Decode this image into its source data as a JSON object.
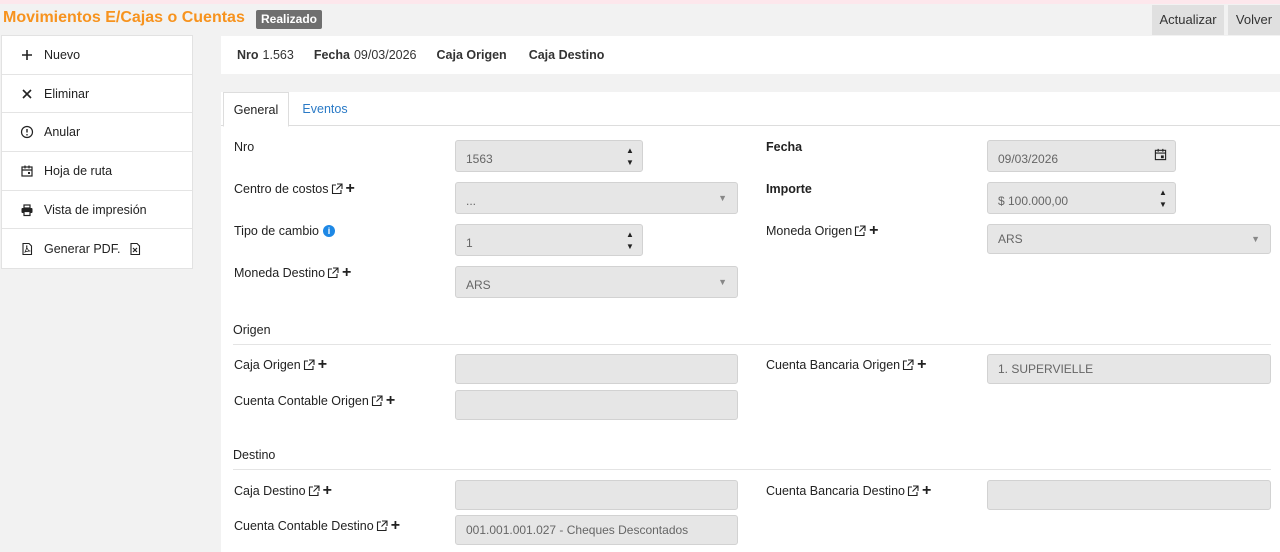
{
  "header": {
    "title": "Movimientos E/Cajas o Cuentas",
    "status_badge": "Realizado",
    "refresh_label": "Actualizar",
    "back_label": "Volver"
  },
  "sidebar": {
    "items": [
      {
        "label": "Nuevo",
        "icon": "plus-icon"
      },
      {
        "label": "Eliminar",
        "icon": "close-icon"
      },
      {
        "label": "Anular",
        "icon": "alert-circle-icon"
      },
      {
        "label": "Hoja de ruta",
        "icon": "calendar-icon"
      },
      {
        "label": "Vista de impresión",
        "icon": "printer-icon"
      },
      {
        "label": "Generar PDF.",
        "icon": "pdf-icon",
        "extra_icon": "excel-icon"
      }
    ]
  },
  "summary": {
    "nro_label": "Nro",
    "nro_value": "1.563",
    "fecha_label": "Fecha",
    "fecha_value": "09/03/2026",
    "caja_origen_label": "Caja Origen",
    "caja_destino_label": "Caja Destino"
  },
  "tabs": [
    {
      "label": "General",
      "active": true
    },
    {
      "label": "Eventos",
      "active": false
    }
  ],
  "form": {
    "nro": {
      "label": "Nro",
      "value": "1563"
    },
    "fecha": {
      "label": "Fecha",
      "value": "09/03/2026"
    },
    "centro_costos": {
      "label": "Centro de costos",
      "value": "..."
    },
    "importe": {
      "label": "Importe",
      "value": "$ 100.000,00"
    },
    "tipo_cambio": {
      "label": "Tipo de cambio",
      "value": "1"
    },
    "moneda_origen": {
      "label": "Moneda Origen",
      "value": "ARS"
    },
    "moneda_destino": {
      "label": "Moneda Destino",
      "value": "ARS"
    }
  },
  "origen": {
    "section_label": "Origen",
    "caja_origen": {
      "label": "Caja Origen",
      "value": ""
    },
    "cuenta_bancaria_origen": {
      "label": "Cuenta Bancaria Origen",
      "value": "1. SUPERVIELLE"
    },
    "cuenta_contable_origen": {
      "label": "Cuenta Contable Origen",
      "value": ""
    }
  },
  "destino": {
    "section_label": "Destino",
    "caja_destino": {
      "label": "Caja Destino",
      "value": ""
    },
    "cuenta_bancaria_destino": {
      "label": "Cuenta Bancaria Destino",
      "value": ""
    },
    "cuenta_contable_destino": {
      "label": "Cuenta Contable Destino",
      "value": "001.001.001.027 - Cheques Descontados"
    }
  },
  "colors": {
    "title": "#f7931e",
    "badge": "#6f6f6f",
    "link": "#2a7ac6",
    "field_bg": "#e6e6e6"
  }
}
